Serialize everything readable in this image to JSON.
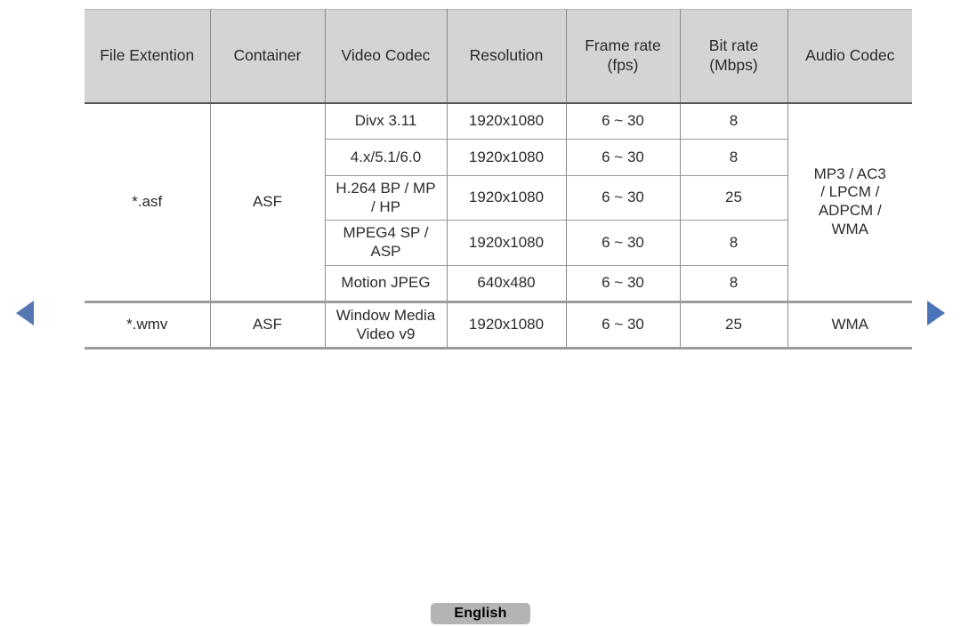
{
  "nav": {
    "prev_label": "previous-page",
    "next_label": "next-page",
    "arrow_color": "#5477b0"
  },
  "footer": {
    "language_label": "English",
    "button_color": "#b4b4b4"
  },
  "table": {
    "header_background": "#d4d4d4",
    "border_color": "#8a8a8a",
    "columns": [
      "File Extention",
      "Container",
      "Video Codec",
      "Resolution",
      "Frame rate\n(fps)",
      "Bit rate\n(Mbps)",
      "Audio Codec"
    ],
    "headers": {
      "file_extention": "File Extention",
      "container": "Container",
      "video_codec": "Video Codec",
      "resolution": "Resolution",
      "frame_rate_line1": "Frame rate",
      "frame_rate_line2": "(fps)",
      "bit_rate_line1": "Bit rate",
      "bit_rate_line2": "(Mbps)",
      "audio_codec": "Audio Codec"
    },
    "groups": [
      {
        "file_extention": "*.asf",
        "container": "ASF",
        "audio_codec_line1": "MP3 / AC3",
        "audio_codec_line2": "/ LPCM /",
        "audio_codec_line3": "ADPCM /",
        "audio_codec_line4": "WMA",
        "rows": [
          {
            "video_codec": "Divx 3.11",
            "resolution": "1920x1080",
            "frame_rate": "6 ~ 30",
            "bit_rate": "8"
          },
          {
            "video_codec": "4.x/5.1/6.0",
            "resolution": "1920x1080",
            "frame_rate": "6 ~ 30",
            "bit_rate": "8"
          },
          {
            "video_codec_line1": "H.264 BP / MP",
            "video_codec_line2": "/ HP",
            "resolution": "1920x1080",
            "frame_rate": "6 ~ 30",
            "bit_rate": "25"
          },
          {
            "video_codec_line1": "MPEG4 SP /",
            "video_codec_line2": "ASP",
            "resolution": "1920x1080",
            "frame_rate": "6 ~ 30",
            "bit_rate": "8"
          },
          {
            "video_codec": "Motion JPEG",
            "resolution": "640x480",
            "frame_rate": "6 ~ 30",
            "bit_rate": "8"
          }
        ]
      },
      {
        "file_extention": "*.wmv",
        "container": "ASF",
        "audio_codec": "WMA",
        "rows": [
          {
            "video_codec_line1": "Window Media",
            "video_codec_line2": "Video v9",
            "resolution": "1920x1080",
            "frame_rate": "6 ~ 30",
            "bit_rate": "25"
          }
        ]
      }
    ]
  }
}
